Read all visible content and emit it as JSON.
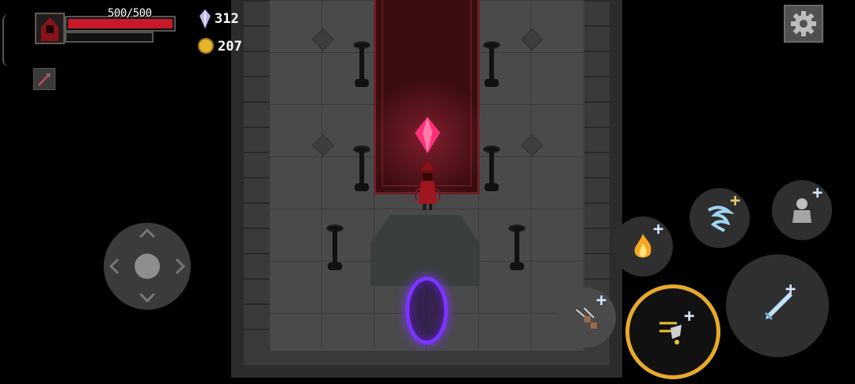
{
  "hud": {
    "hp_text": "500/500",
    "hp_fraction": 1.0,
    "gem_count": "312",
    "gold_count": "207"
  },
  "skills": [
    {
      "name": "fire-burst",
      "upgradable": true
    },
    {
      "name": "water-vortex",
      "upgradable": true
    },
    {
      "name": "spirit-summon",
      "upgradable": true
    },
    {
      "name": "basic-dash",
      "upgradable": true
    },
    {
      "name": "signature-arcana",
      "upgradable": true,
      "selected": true
    },
    {
      "name": "ice-sword",
      "upgradable": true
    }
  ],
  "colors": {
    "hp": "#c8182a",
    "portal": "#7b34ff",
    "crystal": "#ff2f7a",
    "selected_ring": "#e8a92c",
    "carpet": "#3b0d10"
  },
  "icons": {
    "settings": "gear-icon",
    "gem": "gem-icon",
    "gold": "gold-coin-icon",
    "relic": "relic-icon"
  }
}
